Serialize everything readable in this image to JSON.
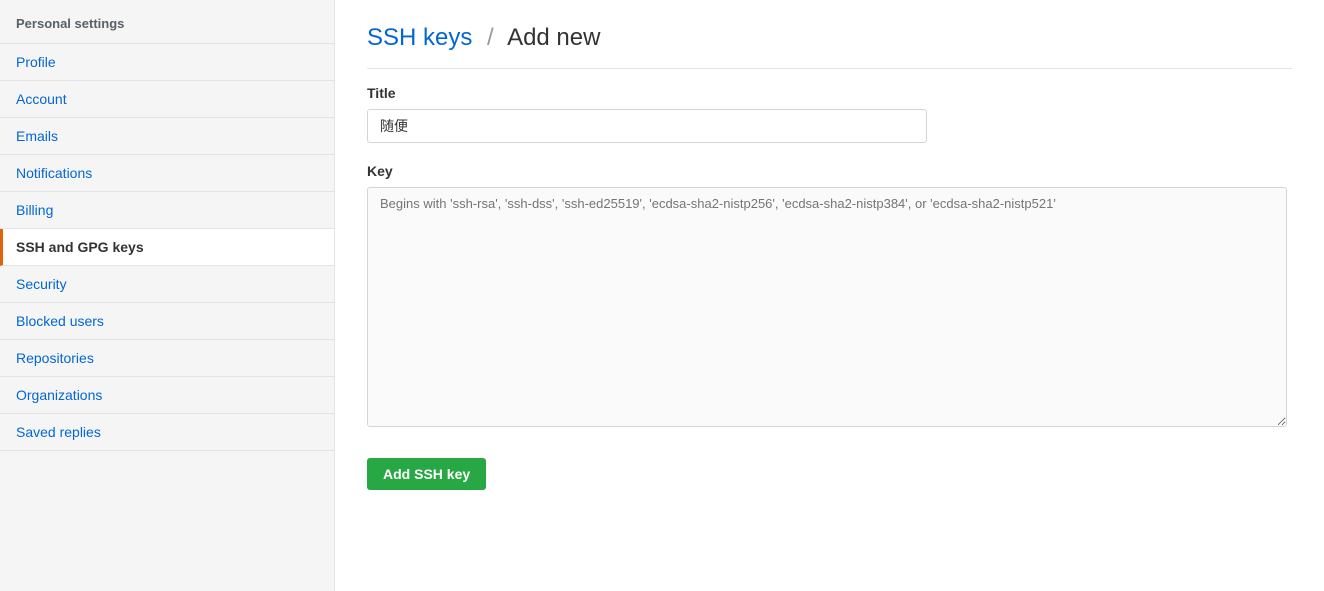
{
  "sidebar": {
    "header": "Personal settings",
    "items": [
      {
        "id": "profile",
        "label": "Profile",
        "active": false
      },
      {
        "id": "account",
        "label": "Account",
        "active": false
      },
      {
        "id": "emails",
        "label": "Emails",
        "active": false
      },
      {
        "id": "notifications",
        "label": "Notifications",
        "active": false
      },
      {
        "id": "billing",
        "label": "Billing",
        "active": false
      },
      {
        "id": "ssh-gpg-keys",
        "label": "SSH and GPG keys",
        "active": true
      },
      {
        "id": "security",
        "label": "Security",
        "active": false
      },
      {
        "id": "blocked-users",
        "label": "Blocked users",
        "active": false
      },
      {
        "id": "repositories",
        "label": "Repositories",
        "active": false
      },
      {
        "id": "organizations",
        "label": "Organizations",
        "active": false
      },
      {
        "id": "saved-replies",
        "label": "Saved replies",
        "active": false
      }
    ]
  },
  "main": {
    "title_part1": "SSH keys",
    "title_separator": "/",
    "title_part2": "Add new",
    "title_label": "SSH keys / Add new",
    "form": {
      "title_label": "Title",
      "title_value": "随便",
      "key_label": "Key",
      "key_placeholder": "Begins with 'ssh-rsa', 'ssh-dss', 'ssh-ed25519', 'ecdsa-sha2-nistp256', 'ecdsa-sha2-nistp384', or 'ecdsa-sha2-nistp521'",
      "submit_label": "Add SSH key"
    }
  }
}
